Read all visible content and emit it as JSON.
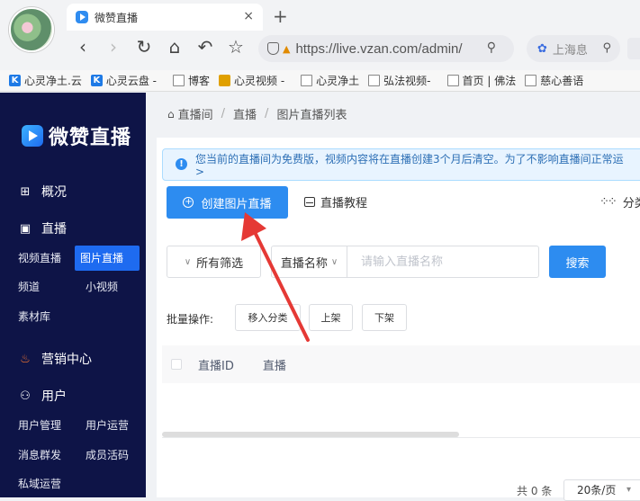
{
  "browser": {
    "tab_title": "微赞直播",
    "tab_close": "×",
    "new_tab": "+",
    "url": "https://live.vzan.com/admin/",
    "search_city": "上海息",
    "bookmarks": [
      {
        "label": "心灵净土.云",
        "icon": "k-icon"
      },
      {
        "label": "心灵云盘 -",
        "icon": "k-icon"
      },
      {
        "label": "博客",
        "icon": "doc-icon"
      },
      {
        "label": "心灵视频 -",
        "icon": "video-icon"
      },
      {
        "label": "心灵净土",
        "icon": "doc-icon"
      },
      {
        "label": "弘法视频-",
        "icon": "doc-icon"
      },
      {
        "label": "首页 | 佛法",
        "icon": "doc-icon"
      },
      {
        "label": "慈心善语",
        "icon": "doc-icon"
      }
    ]
  },
  "sidebar": {
    "brand": "微赞直播",
    "sections": {
      "overview": "概况",
      "live": "直播",
      "marketing": "营销中心",
      "user": "用户"
    },
    "items": {
      "video_live": "视频直播",
      "image_live": "图片直播",
      "channel": "频道",
      "short_video": "小视频",
      "materials": "素材库",
      "user_mgmt": "用户管理",
      "user_ops": "用户运营",
      "mass_msg": "消息群发",
      "member_act": "成员活码",
      "private_ops": "私域运营"
    }
  },
  "breadcrumb": [
    "直播间",
    "直播",
    "图片直播列表"
  ],
  "notice": {
    "line1": "您当前的直播间为免费版，视频内容将在直播创建3个月后清空。为了不影响直播间正常运",
    "line2": ">"
  },
  "toolbar": {
    "create": "创建图片直播",
    "tutorial": "直播教程",
    "category": "分类"
  },
  "filters": {
    "all_filter": "所有筛选",
    "name_select": "直播名称",
    "search_placeholder": "请输入直播名称",
    "search_btn": "搜索"
  },
  "batch": {
    "label": "批量操作:",
    "move": "移入分类",
    "up": "上架",
    "down": "下架"
  },
  "table": {
    "col_id": "直播ID",
    "col_live": "直播"
  },
  "pagination": {
    "total": "共 0 条",
    "page_size": "20条/页"
  }
}
